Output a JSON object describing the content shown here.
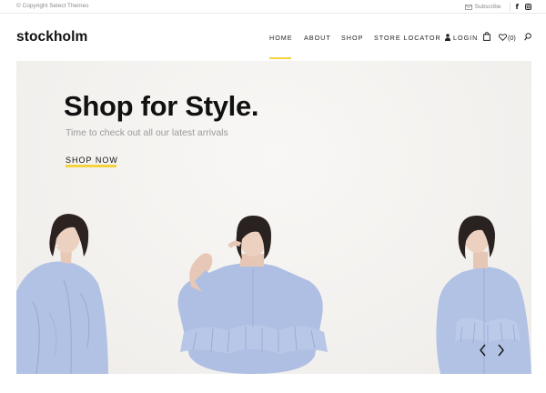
{
  "topbar": {
    "copyright": "© Copyright Select Themes",
    "subscribe_label": "Subscribe",
    "social_icons": [
      "facebook-icon",
      "instagram-icon"
    ]
  },
  "header": {
    "logo": "stockholm",
    "nav": [
      "HOME",
      "ABOUT",
      "SHOP",
      "STORE LOCATOR"
    ],
    "active_nav": "HOME",
    "login_label": "LOGIN",
    "wishlist_count": "(0)",
    "icons": [
      "user-icon",
      "shopping-bag-icon",
      "heart-icon",
      "search-icon"
    ]
  },
  "hero": {
    "title": "Shop for Style.",
    "subtitle": "Time to check out all our latest arrivals",
    "cta": "SHOP NOW",
    "slider_arrows": [
      "chevron-left-icon",
      "chevron-right-icon"
    ]
  },
  "colors": {
    "accent": "#f5d33f",
    "hero_background": "#f4f2ef",
    "text_dark": "#111111",
    "text_muted": "#9a9a9a",
    "shirt_blue": "#aebfe3"
  }
}
